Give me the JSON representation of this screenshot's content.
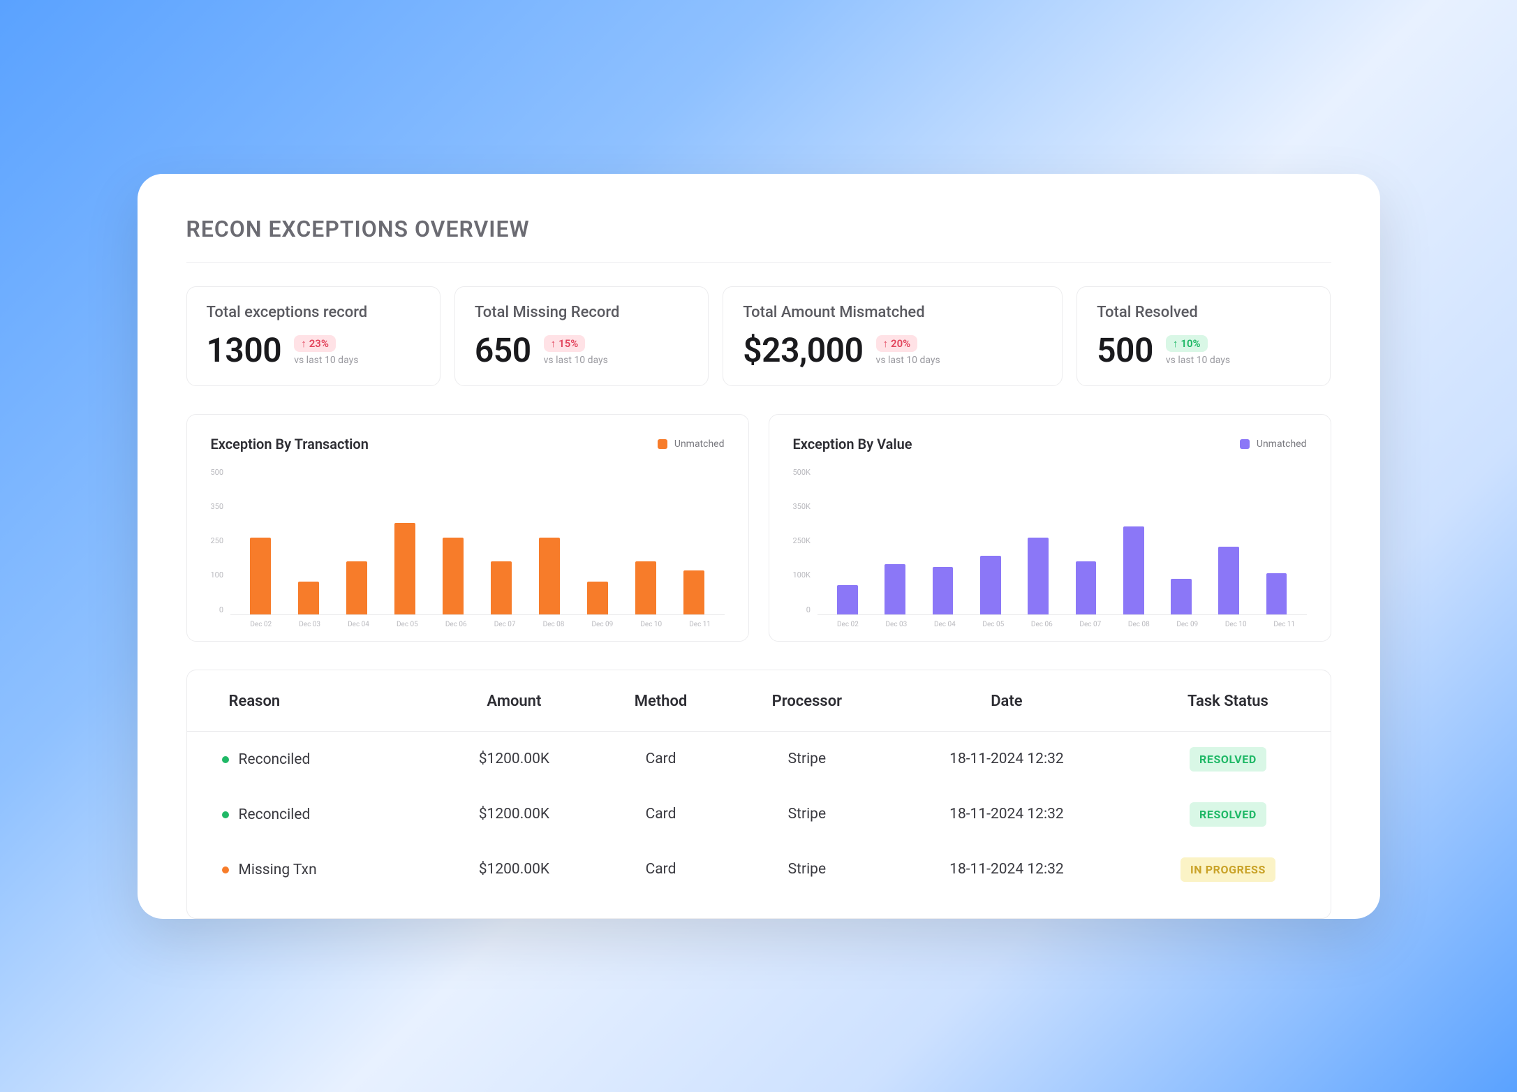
{
  "title": "RECON EXCEPTIONS OVERVIEW",
  "kpis": [
    {
      "label": "Total exceptions record",
      "value": "1300",
      "delta": "23%",
      "delta_dir": "up",
      "delta_sentiment": "bad",
      "sub": "vs last 10 days"
    },
    {
      "label": "Total Missing Record",
      "value": "650",
      "delta": "15%",
      "delta_dir": "up",
      "delta_sentiment": "bad",
      "sub": "vs last 10 days"
    },
    {
      "label": "Total Amount Mismatched",
      "value": "$23,000",
      "delta": "20%",
      "delta_dir": "up",
      "delta_sentiment": "bad",
      "sub": "vs last 10 days"
    },
    {
      "label": "Total Resolved",
      "value": "500",
      "delta": "10%",
      "delta_dir": "up",
      "delta_sentiment": "good",
      "sub": "vs last 10 days"
    }
  ],
  "charts": {
    "transaction": {
      "title": "Exception By Transaction",
      "legend": "Unmatched",
      "color": "#f77c2a"
    },
    "value": {
      "title": "Exception By Value",
      "legend": "Unmatched",
      "color": "#8b77f7"
    }
  },
  "chart_data": [
    {
      "id": "transaction",
      "type": "bar",
      "title": "Exception By Transaction",
      "series_name": "Unmatched",
      "categories": [
        "Dec 02",
        "Dec 03",
        "Dec 04",
        "Dec 05",
        "Dec 06",
        "Dec 07",
        "Dec 08",
        "Dec 09",
        "Dec 10",
        "Dec 11"
      ],
      "values": [
        260,
        110,
        180,
        310,
        260,
        180,
        260,
        110,
        180,
        150
      ],
      "y_ticks": [
        500,
        350,
        250,
        100,
        0
      ],
      "ylim": [
        0,
        500
      ],
      "xlabel": "",
      "ylabel": ""
    },
    {
      "id": "value",
      "type": "bar",
      "title": "Exception By Value",
      "series_name": "Unmatched",
      "categories": [
        "Dec 02",
        "Dec 03",
        "Dec 04",
        "Dec 05",
        "Dec 06",
        "Dec 07",
        "Dec 08",
        "Dec 09",
        "Dec 10",
        "Dec 11"
      ],
      "values": [
        100000,
        170000,
        160000,
        200000,
        260000,
        180000,
        300000,
        120000,
        230000,
        140000
      ],
      "y_ticks": [
        "500K",
        "350K",
        "250K",
        "100K",
        "0"
      ],
      "ylim": [
        0,
        500000
      ],
      "xlabel": "",
      "ylabel": ""
    }
  ],
  "table": {
    "headers": [
      "Reason",
      "Amount",
      "Method",
      "Processor",
      "Date",
      "Task Status"
    ],
    "rows": [
      {
        "reason": "Reconciled",
        "dot": "green",
        "amount": "$1200.00K",
        "method": "Card",
        "processor": "Stripe",
        "date": "18-11-2024 12:32",
        "status": "RESOLVED",
        "status_kind": "resolved"
      },
      {
        "reason": "Reconciled",
        "dot": "green",
        "amount": "$1200.00K",
        "method": "Card",
        "processor": "Stripe",
        "date": "18-11-2024 12:32",
        "status": "RESOLVED",
        "status_kind": "resolved"
      },
      {
        "reason": "Missing Txn",
        "dot": "orange",
        "amount": "$1200.00K",
        "method": "Card",
        "processor": "Stripe",
        "date": "18-11-2024 12:32",
        "status": "IN PROGRESS",
        "status_kind": "progress"
      }
    ]
  }
}
